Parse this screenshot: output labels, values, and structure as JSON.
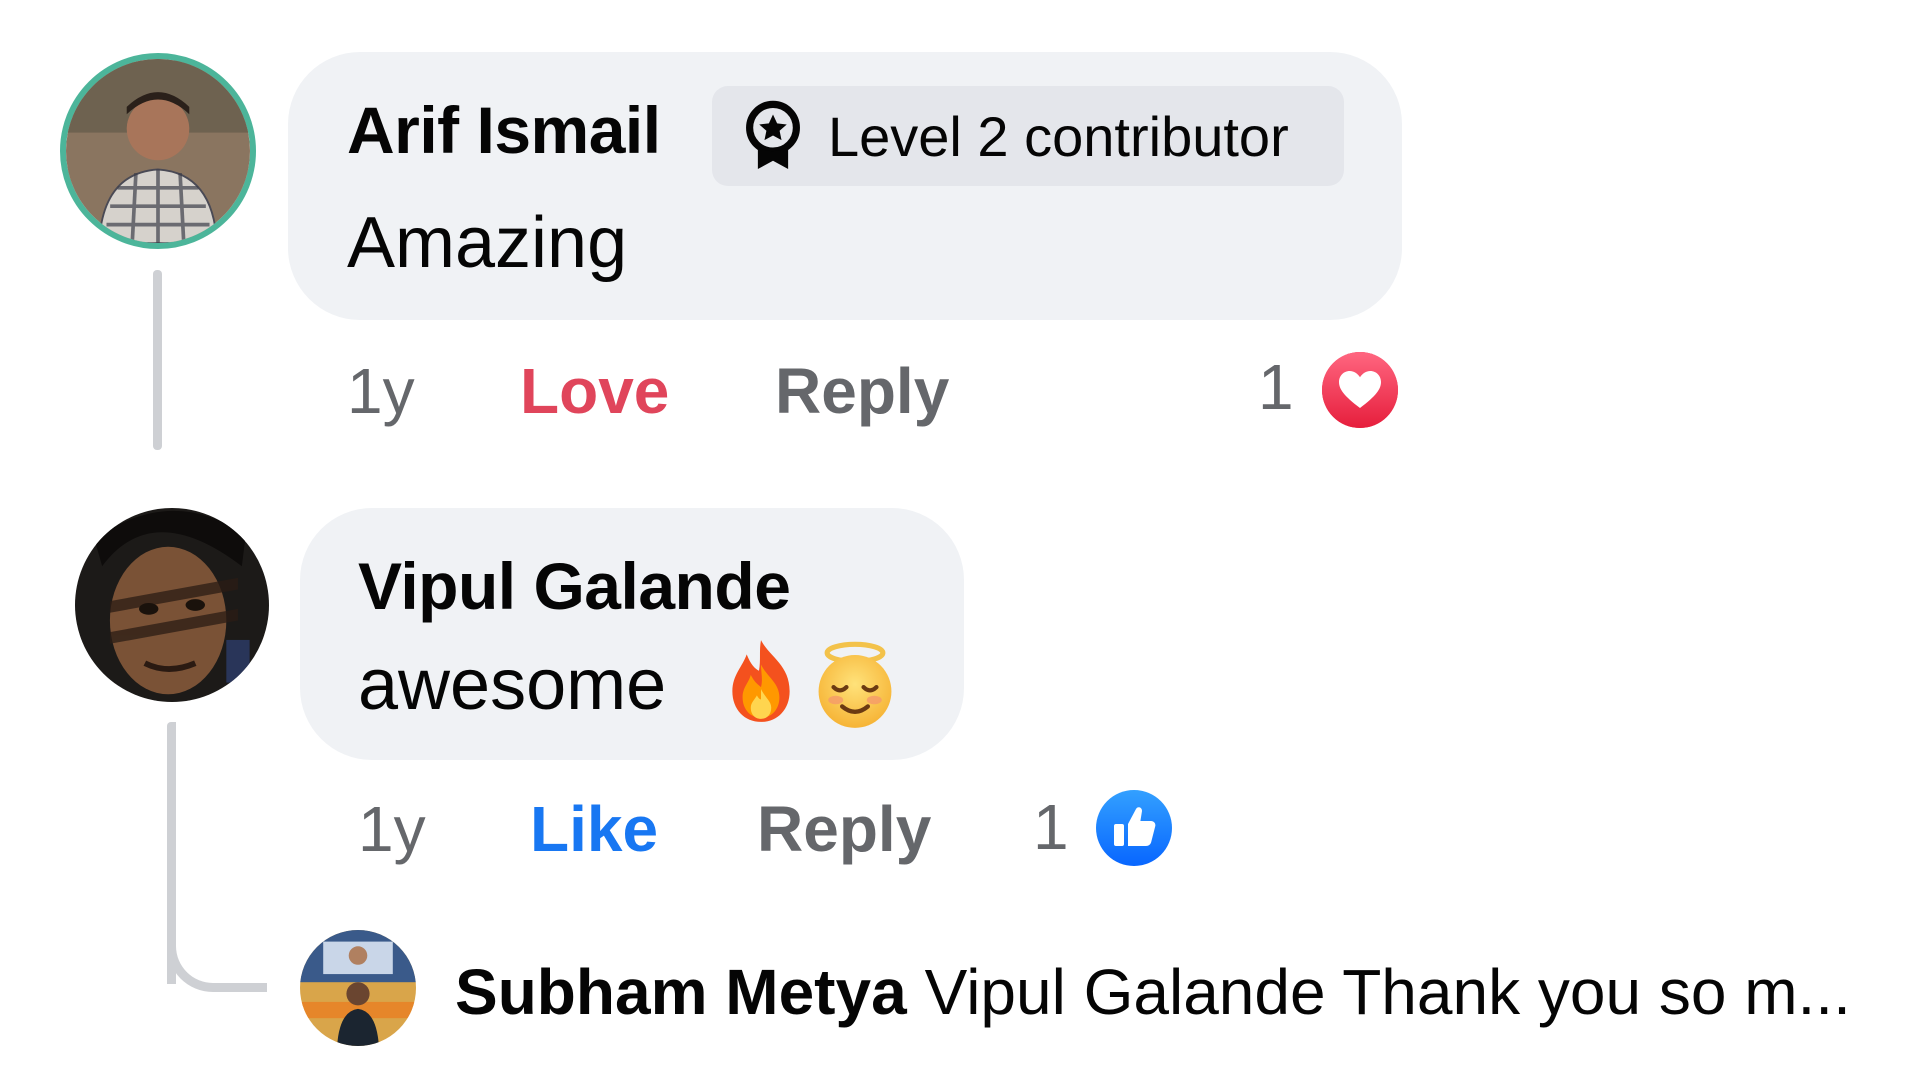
{
  "comments": [
    {
      "author": "Arif Ismail",
      "badge": "Level 2 contributor",
      "text": "Amazing",
      "time": "1y",
      "reaction_action": "Love",
      "reply_label": "Reply",
      "reaction_count": "1",
      "reaction_icon": "heart-icon",
      "reaction_color": "#e0455b"
    },
    {
      "author": "Vipul Galande",
      "text": "awesome",
      "emojis": [
        "fire-emoji",
        "smiling-face-with-halo-emoji"
      ],
      "time": "1y",
      "reaction_action": "Like",
      "reply_label": "Reply",
      "reaction_count": "1",
      "reaction_icon": "thumbs-up-icon",
      "reaction_color": "#1877f2"
    }
  ],
  "reply_preview": {
    "author": "Subham Metya",
    "snippet": "Vipul Galande Thank you so m..."
  },
  "colors": {
    "bubble_bg": "#f0f2f5",
    "badge_bg": "#e4e6eb",
    "secondary_text": "#65676b",
    "thread_line": "#ced0d4",
    "avatar_ring": "#4cb59a"
  }
}
